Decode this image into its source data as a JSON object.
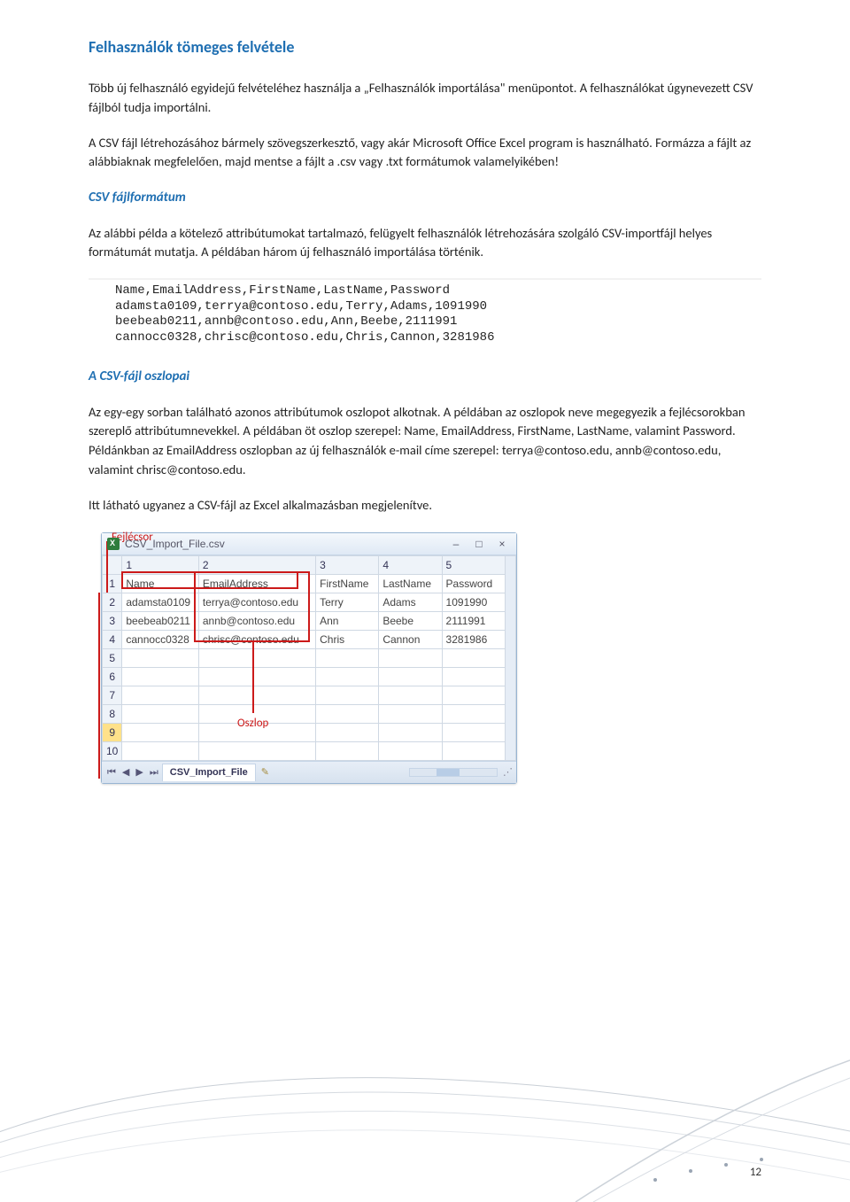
{
  "title": "Felhasználók tömeges felvétele",
  "p1": "Több új felhasználó egyidejű felvételéhez használja a „Felhasználók importálása\" menüpontot. A felhasználókat úgynevezett CSV fájlból tudja importálni.",
  "p2": "A CSV fájl létrehozásához bármely szövegszerkesztő, vagy akár Microsoft Office Excel program is használható. Formázza a fájlt az alábbiaknak megfelelően, majd mentse a fájlt a .csv vagy .txt formátumok valamelyikében!",
  "sub1": "CSV fájlformátum",
  "p3": "Az alábbi példa a kötelező attribútumokat tartalmazó, felügyelt felhasználók létrehozására szolgáló CSV-importfájl helyes formátumát mutatja. A példában három új felhasználó importálása történik.",
  "code": "Name,EmailAddress,FirstName,LastName,Password\nadamsta0109,terrya@contoso.edu,Terry,Adams,1091990\nbeebeab0211,annb@contoso.edu,Ann,Beebe,2111991\ncannocc0328,chrisc@contoso.edu,Chris,Cannon,3281986",
  "sub2": "A CSV-fájl oszlopai",
  "p4": "Az egy-egy sorban található azonos attribútumok oszlopot alkotnak. A példában az oszlopok neve megegyezik a fejlécsorokban szereplő attribútumnevekkel. A példában öt oszlop szerepel: Name, EmailAddress, FirstName, LastName, valamint Password. Példánkban az EmailAddress oszlopban az új felhasználók e-mail címe szerepel: terrya@contoso.edu, annb@contoso.edu, valamint chrisc@contoso.edu.",
  "p5": "Itt látható ugyanez a CSV-fájl az Excel alkalmazásban megjelenítve.",
  "excel": {
    "annot_fejlec": "Fejlécsor",
    "annot_oszlop": "Oszlop",
    "filename": "CSV_Import_File.csv",
    "cols": [
      "1",
      "2",
      "3",
      "4",
      "5"
    ],
    "rows": [
      [
        "1",
        "Name",
        "EmailAddress",
        "FirstName",
        "LastName",
        "Password"
      ],
      [
        "2",
        "adamsta0109",
        "terrya@contoso.edu",
        "Terry",
        "Adams",
        "1091990"
      ],
      [
        "3",
        "beebeab0211",
        "annb@contoso.edu",
        "Ann",
        "Beebe",
        "2111991"
      ],
      [
        "4",
        "cannocc0328",
        "chrisc@contoso.edu",
        "Chris",
        "Cannon",
        "3281986"
      ],
      [
        "5",
        "",
        "",
        "",
        "",
        ""
      ],
      [
        "6",
        "",
        "",
        "",
        "",
        ""
      ],
      [
        "7",
        "",
        "",
        "",
        "",
        ""
      ],
      [
        "8",
        "",
        "",
        "",
        "",
        ""
      ],
      [
        "9",
        "",
        "",
        "",
        "",
        ""
      ],
      [
        "10",
        "",
        "",
        "",
        "",
        ""
      ]
    ],
    "sheet": "CSV_Import_File"
  },
  "page_number": "12"
}
